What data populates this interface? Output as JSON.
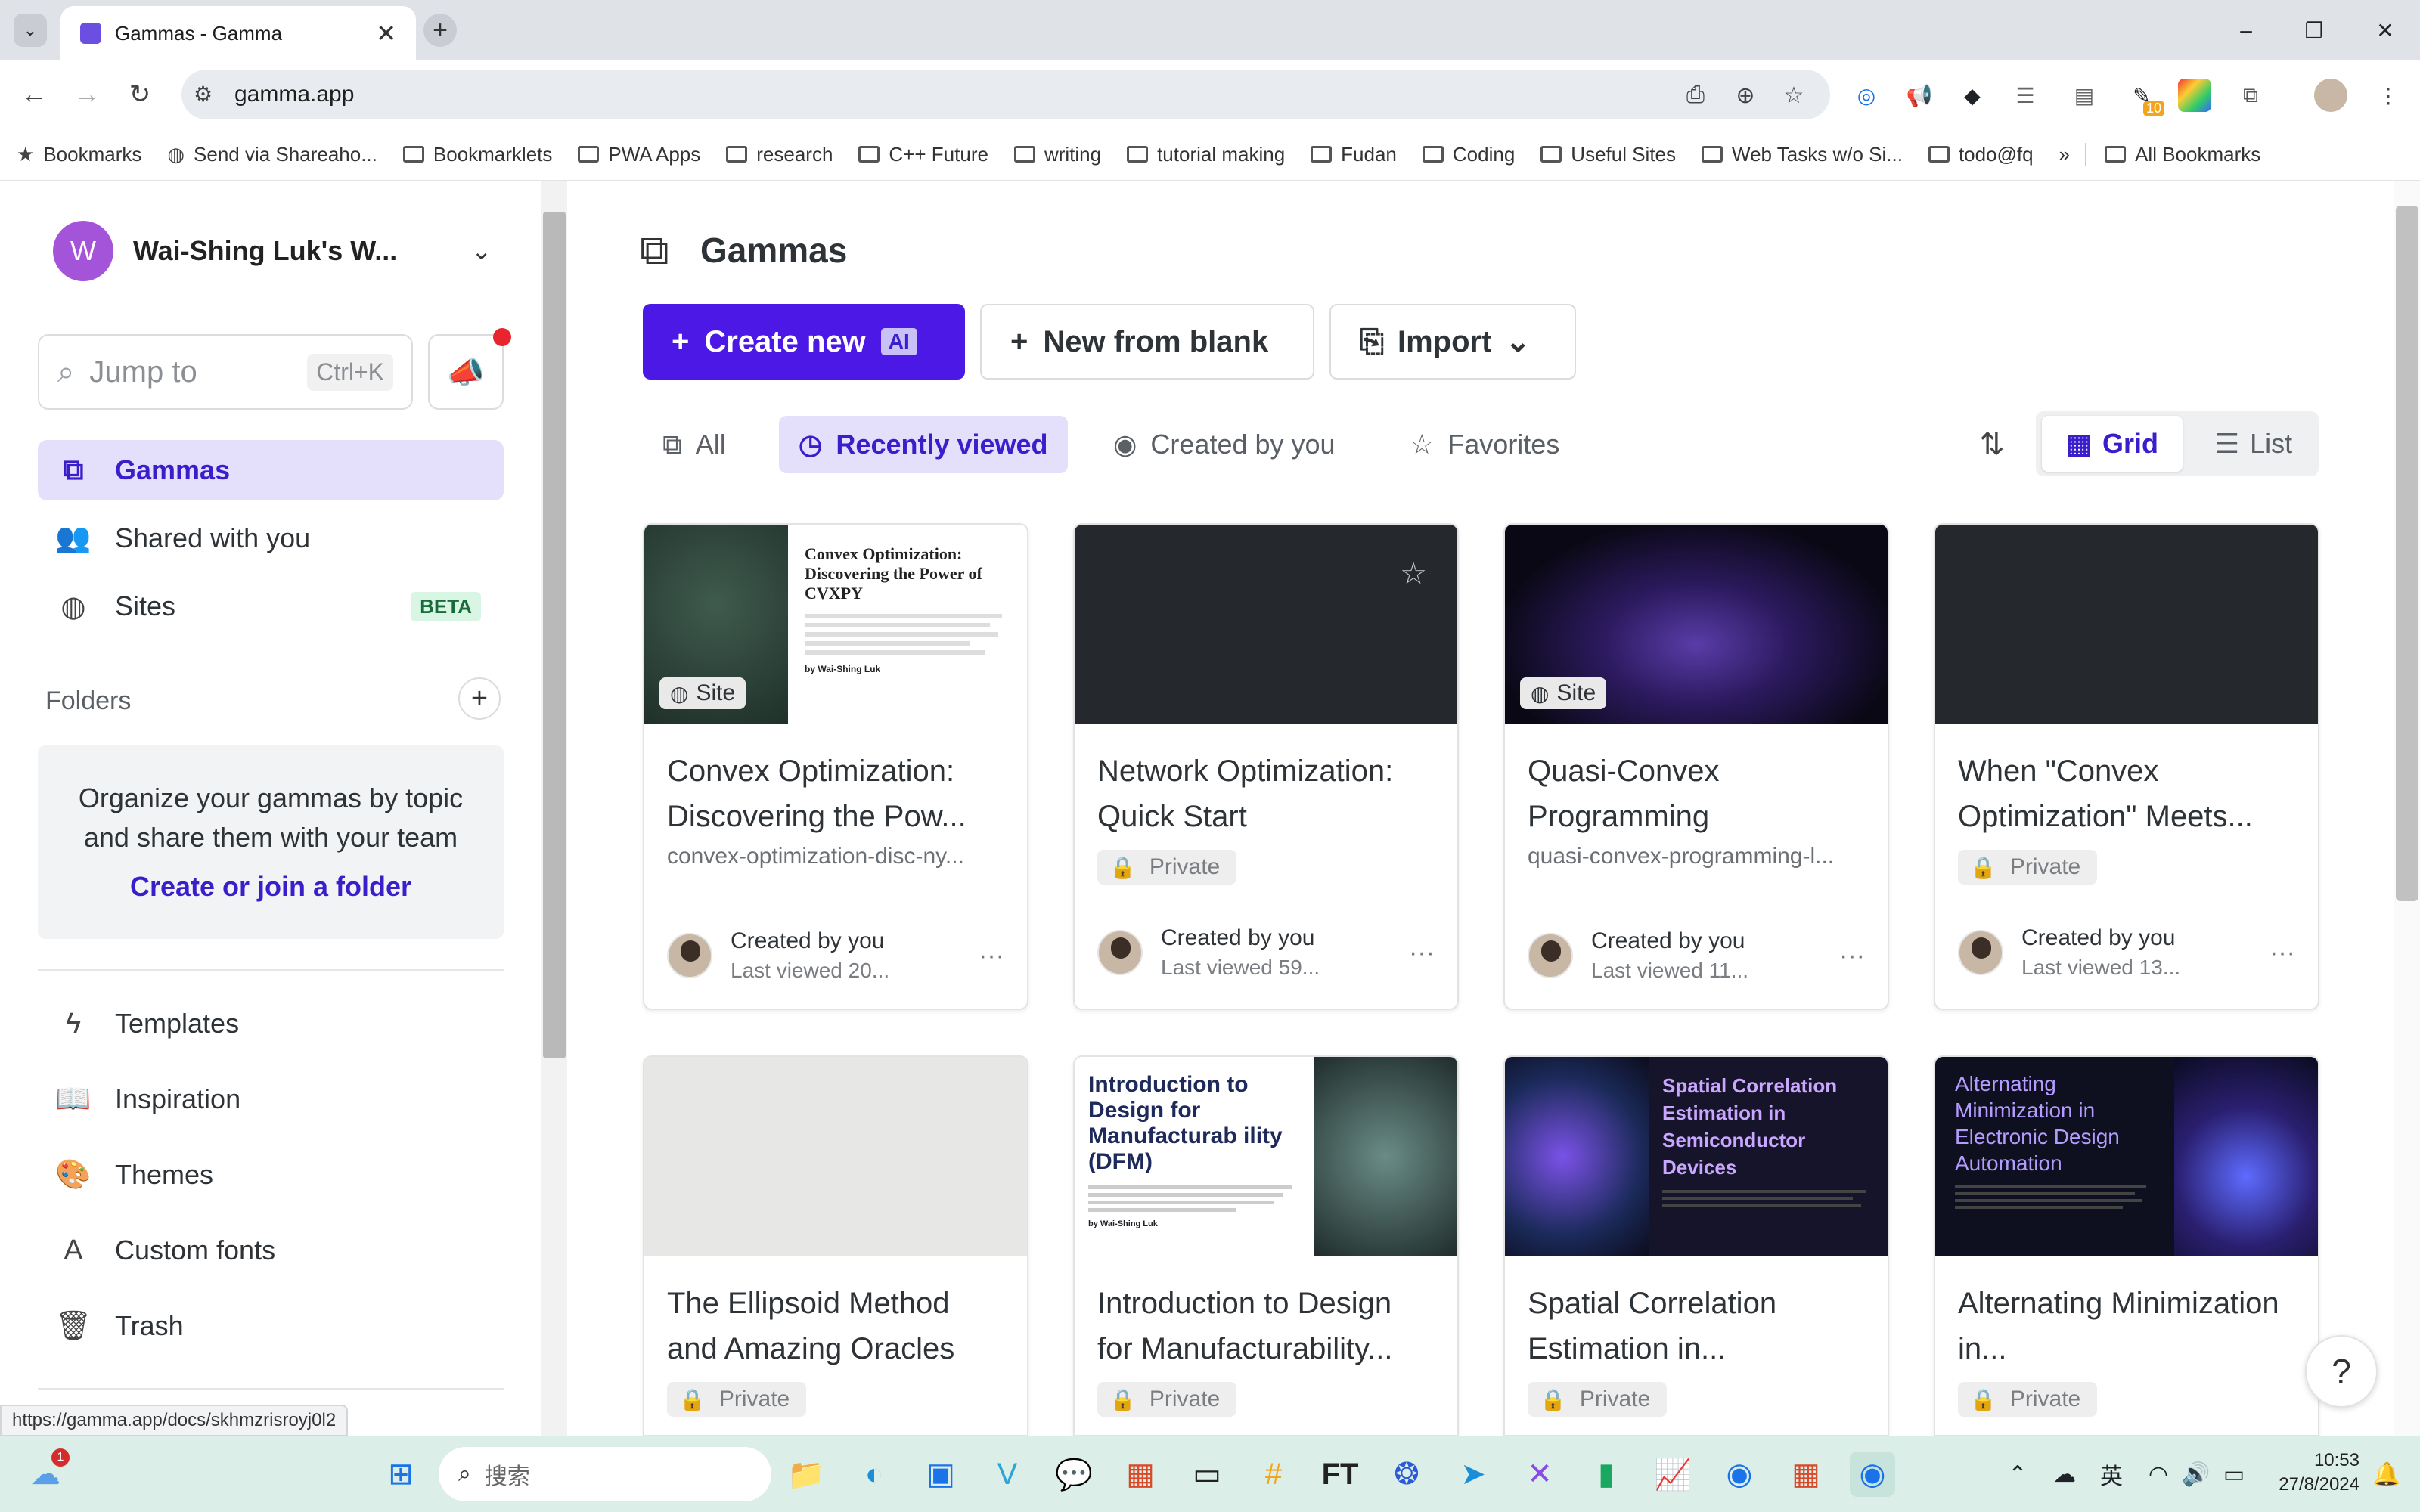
{
  "browser": {
    "tab_title": "Gammas - Gamma",
    "url": "gamma.app",
    "bookmarks": [
      "Bookmarks",
      "Send via Shareaho...",
      "Bookmarklets",
      "PWA Apps",
      "research",
      "C++ Future",
      "writing",
      "tutorial making",
      "Fudan",
      "Coding",
      "Useful Sites",
      "Web Tasks w/o Si...",
      "todo@fq"
    ],
    "all_bookmarks": "All Bookmarks",
    "more": "»",
    "extension_badge": "10",
    "status_url": "https://gamma.app/docs/skhmzrisroyj0l2"
  },
  "sidebar": {
    "workspace_initial": "W",
    "workspace_name": "Wai-Shing Luk's W...",
    "jump_placeholder": "Jump to",
    "jump_shortcut": "Ctrl+K",
    "nav": [
      {
        "label": "Gammas"
      },
      {
        "label": "Shared with you"
      },
      {
        "label": "Sites",
        "badge": "BETA"
      }
    ],
    "folders_label": "Folders",
    "folders_desc": "Organize your gammas by topic and share them with your team",
    "folders_link": "Create or join a folder",
    "bottom_nav": [
      {
        "label": "Templates"
      },
      {
        "label": "Inspiration"
      },
      {
        "label": "Themes"
      },
      {
        "label": "Custom fonts"
      },
      {
        "label": "Trash"
      }
    ]
  },
  "main": {
    "title": "Gammas",
    "create_new": "Create new",
    "ai_badge": "AI",
    "new_from_blank": "New from blank",
    "import": "Import",
    "filters": [
      "All",
      "Recently viewed",
      "Created by you",
      "Favorites"
    ],
    "view_grid": "Grid",
    "view_list": "List",
    "cards": [
      {
        "title": "Convex Optimization: Discovering the Pow...",
        "sub": "convex-optimization-disc-ny...",
        "badge": "Site",
        "who": "Created by you",
        "when": "Last viewed 20...",
        "thumb_title": "Convex Optimization: Discovering the Power of CVXPY",
        "thumb_author": "by Wai-Shing Luk"
      },
      {
        "title": "Network Optimization: Quick Start",
        "private": "Private",
        "who": "Created by you",
        "when": "Last viewed 59..."
      },
      {
        "title": "Quasi-Convex Programming",
        "sub": "quasi-convex-programming-l...",
        "badge": "Site",
        "who": "Created by you",
        "when": "Last viewed 11..."
      },
      {
        "title": "When \"Convex Optimization\" Meets...",
        "private": "Private",
        "who": "Created by you",
        "when": "Last viewed 13..."
      },
      {
        "title": "The Ellipsoid Method and Amazing Oracles",
        "private": "Private"
      },
      {
        "title": "Introduction to Design for Manufacturability...",
        "private": "Private",
        "thumb_title": "Introduction to Design for Manufacturab ility (DFM)",
        "thumb_author": "by Wai-Shing Luk"
      },
      {
        "title": "Spatial Correlation Estimation in...",
        "private": "Private",
        "thumb_title": "Spatial Correlation Estimation in Semiconductor Devices"
      },
      {
        "title": "Alternating Minimization in...",
        "private": "Private",
        "thumb_title": "Alternating Minimization in Electronic Design Automation"
      }
    ],
    "help": "?"
  },
  "taskbar": {
    "search_placeholder": "搜索",
    "time": "10:53",
    "date": "27/8/2024",
    "ime": "英",
    "weather_badge": "1"
  },
  "colors": {
    "accent": "#4c18e6",
    "accent_soft": "#e4e0fb"
  }
}
